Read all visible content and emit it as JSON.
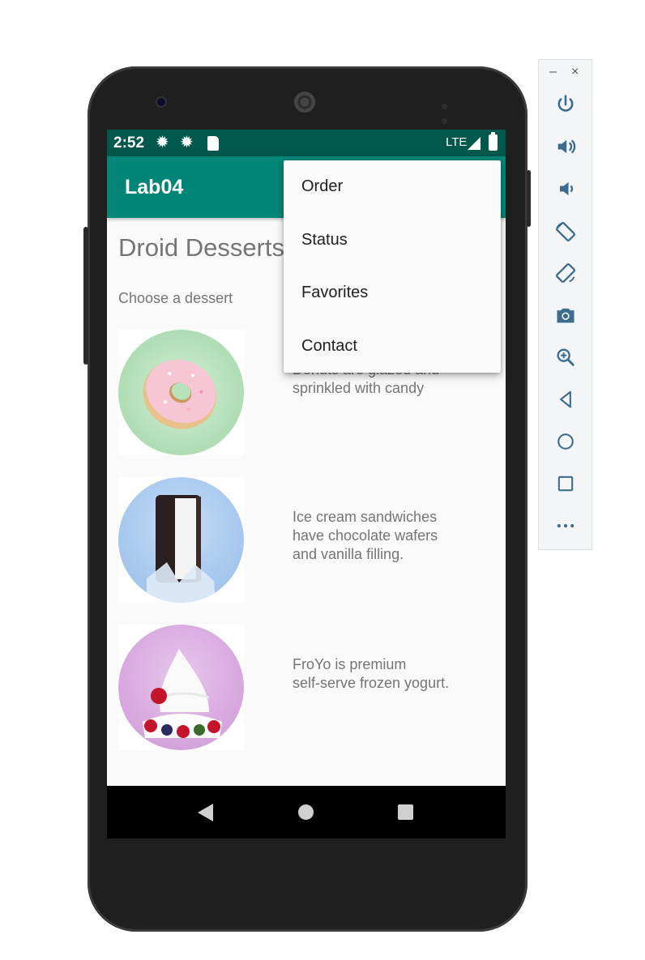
{
  "status_bar": {
    "time": "2:52",
    "network": "LTE"
  },
  "app_bar": {
    "title": "Lab04"
  },
  "main": {
    "title": "Droid Desserts",
    "subtitle": "Choose a dessert",
    "desserts": [
      {
        "name": "donut",
        "description": "Donuts are glazed and\nsprinkled with candy"
      },
      {
        "name": "ice-cream-sandwich",
        "description": "Ice cream sandwiches\nhave chocolate wafers\nand vanilla filling."
      },
      {
        "name": "froyo",
        "description": "FroYo is premium\nself-serve frozen yogurt."
      }
    ]
  },
  "overflow_menu": {
    "items": [
      {
        "label": "Order"
      },
      {
        "label": "Status"
      },
      {
        "label": "Favorites"
      },
      {
        "label": "Contact"
      }
    ]
  },
  "emulator_toolbar": {
    "minimize": "–",
    "close": "×",
    "buttons": [
      "power-icon",
      "volume-up-icon",
      "volume-down-icon",
      "rotate-left-icon",
      "rotate-right-icon",
      "camera-icon",
      "zoom-icon",
      "back-icon",
      "home-icon",
      "overview-icon",
      "more-icon"
    ]
  },
  "colors": {
    "status_bar": "#00574b",
    "app_bar": "#008577",
    "toolbar_icon": "#3c6d8e"
  }
}
